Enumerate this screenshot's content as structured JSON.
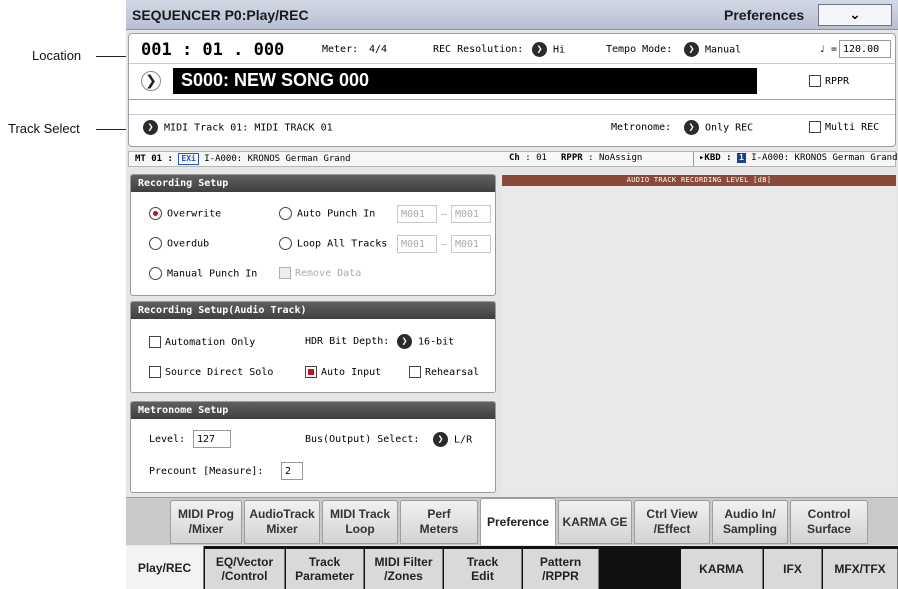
{
  "callouts": {
    "location": "Location",
    "track_select": "Track Select"
  },
  "title_bar": {
    "title": "SEQUENCER P0:Play/REC",
    "menu_label": "Preferences",
    "menu_icon": "chevron-down-icon"
  },
  "location_row": {
    "location": "001 : 01 . 000",
    "meter_label": "Meter:",
    "meter_value": "4/4",
    "rec_res_label": "REC Resolution:",
    "rec_res_value": "Hi",
    "tempo_mode_label": "Tempo Mode:",
    "tempo_mode_value": "Manual",
    "tempo_symbol": "♩ =",
    "tempo_value": "120.00"
  },
  "song_row": {
    "song_name": "S000: NEW SONG 000",
    "rppr_label": "RPPR",
    "rppr_checked": false
  },
  "track_row": {
    "track_select": "MIDI Track 01: MIDI TRACK 01",
    "metronome_label": "Metronome:",
    "metronome_value": "Only REC",
    "multi_rec_label": "Multi REC",
    "multi_rec_checked": false
  },
  "info_strip": {
    "mt_label": "MT 01 :",
    "mt_badge": "EXi",
    "mt_program": "I-A000: KRONOS German Grand",
    "ch_label": "Ch",
    "ch_value": ": 01",
    "rppr_label": "RPPR",
    "rppr_value": ": NoAssign",
    "kbd_label": "▸KBD :",
    "kbd_badge": "1",
    "kbd_program": "I-A000: KRONOS German Grand"
  },
  "recording_setup": {
    "title": "Recording Setup",
    "overwrite": "Overwrite",
    "overdub": "Overdub",
    "manual_punch_in": "Manual Punch In",
    "auto_punch_in": "Auto Punch In",
    "loop_all_tracks": "Loop All Tracks",
    "remove_data": "Remove Data",
    "auto_punch_start": "M001",
    "auto_punch_end": "M001",
    "loop_start": "M001",
    "loop_end": "M001",
    "range_sep": "–",
    "selected": "Overwrite"
  },
  "audio_setup": {
    "title": "Recording Setup(Audio Track)",
    "automation_only": "Automation Only",
    "hdr_label": "HDR Bit Depth:",
    "hdr_value": "16-bit",
    "source_direct_solo": "Source Direct Solo",
    "auto_input": "Auto Input",
    "auto_input_checked": true,
    "rehearsal": "Rehearsal"
  },
  "metronome_setup": {
    "title": "Metronome Setup",
    "level_label": "Level:",
    "level_value": "127",
    "bus_label": "Bus(Output) Select:",
    "bus_value": "L/R",
    "precount_label": "Precount [Measure]:",
    "precount_value": "2"
  },
  "meter": {
    "header": "AUDIO TRACK RECORDING LEVEL [dB]"
  },
  "page_tabs": {
    "t1": "MIDI Prog /Mixer",
    "t2": "AudioTrack Mixer",
    "t3": "MIDI Track Loop",
    "t4": "Perf Meters",
    "t5": "Preference",
    "t6": "KARMA GE",
    "t7": "Ctrl View /Effect",
    "t8": "Audio In/ Sampling",
    "t9": "Control Surface",
    "active": "Preference"
  },
  "mode_tabs": {
    "m1": "Play/REC",
    "m2": "EQ/Vector /Control",
    "m3": "Track Parameter",
    "m4": "MIDI Filter /Zones",
    "m5": "Track Edit",
    "m6": "Pattern /RPPR",
    "m7": "KARMA",
    "m8": "IFX",
    "m9": "MFX/TFX",
    "active": "Play/REC"
  }
}
